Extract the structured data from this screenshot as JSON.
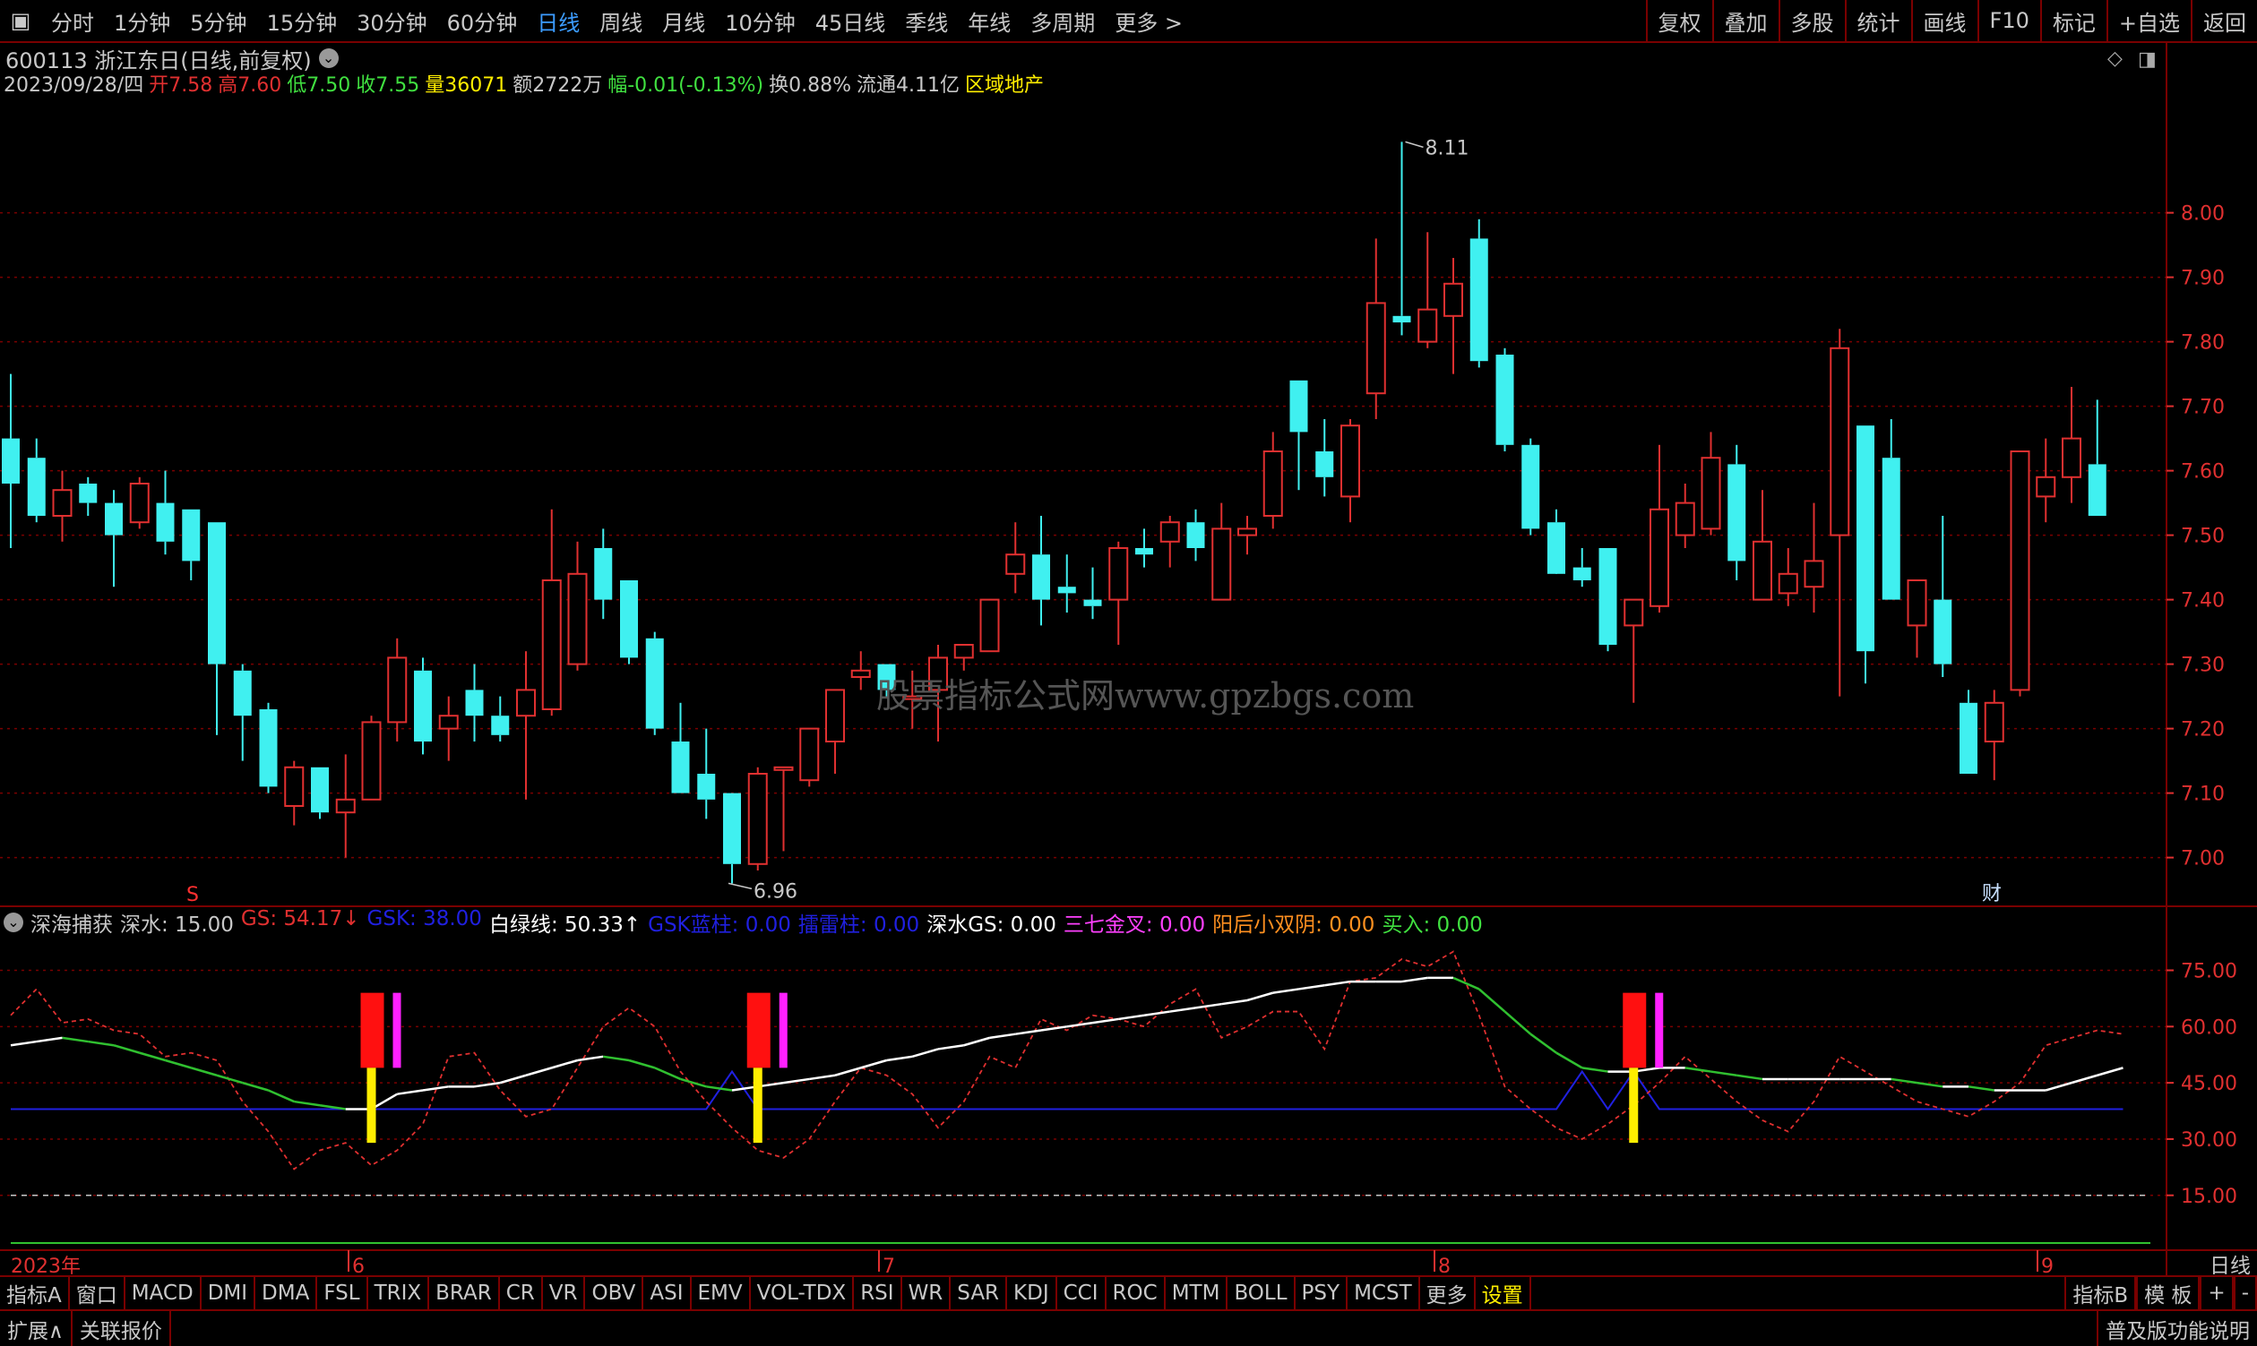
{
  "top_bar": {
    "periods": [
      {
        "label": "分时",
        "active": false
      },
      {
        "label": "1分钟",
        "active": false
      },
      {
        "label": "5分钟",
        "active": false
      },
      {
        "label": "15分钟",
        "active": false
      },
      {
        "label": "30分钟",
        "active": false
      },
      {
        "label": "60分钟",
        "active": false
      },
      {
        "label": "日线",
        "active": true
      },
      {
        "label": "周线",
        "active": false
      },
      {
        "label": "月线",
        "active": false
      },
      {
        "label": "10分钟",
        "active": false
      },
      {
        "label": "45日线",
        "active": false
      },
      {
        "label": "季线",
        "active": false
      },
      {
        "label": "年线",
        "active": false
      },
      {
        "label": "多周期",
        "active": false
      },
      {
        "label": "更多 >",
        "active": false
      }
    ],
    "tools": [
      "复权",
      "叠加",
      "多股",
      "统计",
      "画线",
      "F10",
      "标记",
      "+自选",
      "返回"
    ]
  },
  "stock": {
    "title": "600113 浙江东日(日线,前复权)",
    "date": "2023/09/28/四",
    "open": "开7.58",
    "high": "高7.60",
    "low": "低7.50",
    "close": "收7.55",
    "volume": "量36071",
    "amount": "额2722万",
    "change": "幅-0.01(-0.13%)",
    "turnover": "换0.88%",
    "float": "流通4.11亿",
    "sector": "区域地产"
  },
  "price_axis": [
    "8.00",
    "7.90",
    "7.80",
    "7.70",
    "7.60",
    "7.50",
    "7.40",
    "7.30",
    "7.20",
    "7.10",
    "7.00"
  ],
  "annotations": {
    "max_label": "8.11",
    "min_label": "6.96",
    "s_marker": "S",
    "cai_marker": "财",
    "watermark": "股票指标公式网www.gpzbgs.com"
  },
  "indicator": {
    "name": "深海捕获",
    "items": [
      {
        "label": "深水: 15.00",
        "color": "#c8c8c8"
      },
      {
        "label": "GS: 54.17↓",
        "color": "#e03030"
      },
      {
        "label": "GSK: 38.00",
        "color": "#2020e0"
      },
      {
        "label": "白绿线: 50.33↑",
        "color": "#ffffff"
      },
      {
        "label": "GSK蓝柱: 0.00",
        "color": "#2020e0"
      },
      {
        "label": "擂雷柱: 0.00",
        "color": "#2020e0"
      },
      {
        "label": "深水GS: 0.00",
        "color": "#ffffff"
      },
      {
        "label": "三七金叉: 0.00",
        "color": "#ff40ff"
      },
      {
        "label": "阳后小双阴: 0.00",
        "color": "#ff9020"
      },
      {
        "label": "买入: 0.00",
        "color": "#40e040"
      }
    ],
    "axis": [
      "75.00",
      "60.00",
      "45.00",
      "30.00",
      "15.00"
    ]
  },
  "date_axis": {
    "labels": [
      "2023年",
      "6",
      "7",
      "8",
      "9"
    ],
    "period": "日线"
  },
  "tabs": [
    "指标A",
    "窗口",
    "MACD",
    "DMI",
    "DMA",
    "FSL",
    "TRIX",
    "BRAR",
    "CR",
    "VR",
    "OBV",
    "ASI",
    "EMV",
    "VOL-TDX",
    "RSI",
    "WR",
    "SAR",
    "KDJ",
    "CCI",
    "ROC",
    "MTM",
    "BOLL",
    "PSY",
    "MCST",
    "更多",
    "设置"
  ],
  "tabs_right": [
    "指标B",
    "模 板",
    "+",
    "-"
  ],
  "status": {
    "expand": "扩展∧",
    "linked": "关联报价",
    "version": "普及版功能说明"
  },
  "colors": {
    "up": "#e03030",
    "down": "#40f0f0",
    "grid": "#7a0000",
    "white_line": "#ffffff",
    "green_line": "#30c030"
  },
  "chart_data": {
    "type": "candlestick",
    "ylim": [
      6.93,
      8.18
    ],
    "candles": [
      [
        7.65,
        7.75,
        7.48,
        7.58
      ],
      [
        7.62,
        7.65,
        7.52,
        7.53
      ],
      [
        7.53,
        7.6,
        7.49,
        7.57
      ],
      [
        7.58,
        7.59,
        7.53,
        7.55
      ],
      [
        7.55,
        7.57,
        7.42,
        7.5
      ],
      [
        7.52,
        7.59,
        7.51,
        7.58
      ],
      [
        7.55,
        7.6,
        7.47,
        7.49
      ],
      [
        7.54,
        7.54,
        7.43,
        7.46
      ],
      [
        7.52,
        7.52,
        7.19,
        7.3
      ],
      [
        7.29,
        7.3,
        7.15,
        7.22
      ],
      [
        7.23,
        7.24,
        7.1,
        7.11
      ],
      [
        7.08,
        7.15,
        7.05,
        7.14
      ],
      [
        7.14,
        7.14,
        7.06,
        7.07
      ],
      [
        7.07,
        7.16,
        7.0,
        7.09
      ],
      [
        7.09,
        7.22,
        7.09,
        7.21
      ],
      [
        7.21,
        7.34,
        7.18,
        7.31
      ],
      [
        7.29,
        7.31,
        7.16,
        7.18
      ],
      [
        7.2,
        7.25,
        7.15,
        7.22
      ],
      [
        7.26,
        7.3,
        7.18,
        7.22
      ],
      [
        7.22,
        7.25,
        7.18,
        7.19
      ],
      [
        7.22,
        7.32,
        7.09,
        7.26
      ],
      [
        7.23,
        7.54,
        7.22,
        7.43
      ],
      [
        7.3,
        7.49,
        7.29,
        7.44
      ],
      [
        7.48,
        7.51,
        7.37,
        7.4
      ],
      [
        7.43,
        7.43,
        7.3,
        7.31
      ],
      [
        7.34,
        7.35,
        7.19,
        7.2
      ],
      [
        7.18,
        7.24,
        7.1,
        7.1
      ],
      [
        7.13,
        7.2,
        7.06,
        7.09
      ],
      [
        7.1,
        7.09,
        6.96,
        6.99
      ],
      [
        6.99,
        7.14,
        6.98,
        7.13
      ],
      [
        7.14,
        7.13,
        7.01,
        7.14
      ],
      [
        7.12,
        7.2,
        7.11,
        7.2
      ],
      [
        7.18,
        7.24,
        7.13,
        7.26
      ],
      [
        7.28,
        7.32,
        7.26,
        7.29
      ],
      [
        7.3,
        7.3,
        7.25,
        7.26
      ],
      [
        7.25,
        7.29,
        7.2,
        7.25
      ],
      [
        7.26,
        7.33,
        7.18,
        7.31
      ],
      [
        7.31,
        7.33,
        7.29,
        7.33
      ],
      [
        7.32,
        7.39,
        7.32,
        7.4
      ],
      [
        7.44,
        7.52,
        7.41,
        7.47
      ],
      [
        7.47,
        7.53,
        7.36,
        7.4
      ],
      [
        7.42,
        7.47,
        7.38,
        7.41
      ],
      [
        7.4,
        7.45,
        7.37,
        7.39
      ],
      [
        7.4,
        7.49,
        7.33,
        7.48
      ],
      [
        7.48,
        7.51,
        7.45,
        7.47
      ],
      [
        7.49,
        7.53,
        7.45,
        7.52
      ],
      [
        7.52,
        7.54,
        7.46,
        7.48
      ],
      [
        7.4,
        7.55,
        7.4,
        7.51
      ],
      [
        7.5,
        7.53,
        7.47,
        7.51
      ],
      [
        7.53,
        7.66,
        7.51,
        7.63
      ],
      [
        7.74,
        7.74,
        7.57,
        7.66
      ],
      [
        7.63,
        7.68,
        7.56,
        7.59
      ],
      [
        7.56,
        7.68,
        7.52,
        7.67
      ],
      [
        7.72,
        7.96,
        7.68,
        7.86
      ],
      [
        7.84,
        8.11,
        7.81,
        7.83
      ],
      [
        7.8,
        7.97,
        7.79,
        7.85
      ],
      [
        7.84,
        7.93,
        7.75,
        7.89
      ],
      [
        7.96,
        7.99,
        7.76,
        7.77
      ],
      [
        7.78,
        7.79,
        7.63,
        7.64
      ],
      [
        7.64,
        7.65,
        7.5,
        7.51
      ],
      [
        7.52,
        7.54,
        7.47,
        7.44
      ],
      [
        7.45,
        7.48,
        7.42,
        7.43
      ],
      [
        7.48,
        7.48,
        7.32,
        7.33
      ],
      [
        7.36,
        7.4,
        7.24,
        7.4
      ],
      [
        7.39,
        7.64,
        7.38,
        7.54
      ],
      [
        7.5,
        7.58,
        7.48,
        7.55
      ],
      [
        7.51,
        7.66,
        7.5,
        7.62
      ],
      [
        7.61,
        7.64,
        7.43,
        7.46
      ],
      [
        7.4,
        7.57,
        7.4,
        7.49
      ],
      [
        7.41,
        7.48,
        7.39,
        7.44
      ],
      [
        7.42,
        7.55,
        7.38,
        7.46
      ],
      [
        7.5,
        7.82,
        7.25,
        7.79
      ],
      [
        7.67,
        7.67,
        7.27,
        7.32
      ],
      [
        7.62,
        7.68,
        7.4,
        7.4
      ],
      [
        7.36,
        7.43,
        7.31,
        7.43
      ],
      [
        7.4,
        7.53,
        7.28,
        7.3
      ],
      [
        7.24,
        7.26,
        7.13,
        7.13
      ],
      [
        7.18,
        7.26,
        7.12,
        7.24
      ],
      [
        7.26,
        7.63,
        7.25,
        7.63
      ],
      [
        7.56,
        7.65,
        7.52,
        7.59
      ],
      [
        7.59,
        7.73,
        7.55,
        7.65
      ],
      [
        7.61,
        7.71,
        7.53,
        7.53
      ]
    ],
    "indicator_series": {
      "gs": [
        63,
        70,
        61,
        62,
        59,
        58,
        52,
        53,
        51,
        40,
        32,
        22,
        27,
        29,
        23,
        27,
        34,
        52,
        53,
        43,
        36,
        38,
        49,
        60,
        65,
        60,
        48,
        40,
        33,
        27,
        25,
        30,
        40,
        49,
        47,
        42,
        33,
        40,
        52,
        49,
        62,
        59,
        63,
        62,
        60,
        66,
        70,
        57,
        60,
        64,
        64,
        54,
        72,
        73,
        78,
        76,
        80,
        63,
        44,
        38,
        33,
        30,
        34,
        39,
        45,
        52,
        46,
        40,
        35,
        32,
        40,
        52,
        48,
        44,
        40,
        38,
        36,
        40,
        45,
        55,
        57,
        59,
        58
      ],
      "white_green": [
        55,
        56,
        57,
        56,
        55,
        53,
        51,
        49,
        47,
        45,
        43,
        40,
        39,
        38,
        38,
        42,
        43,
        44,
        44,
        45,
        47,
        49,
        51,
        52,
        51,
        49,
        46,
        44,
        43,
        44,
        45,
        46,
        47,
        49,
        51,
        52,
        54,
        55,
        57,
        58,
        59,
        60,
        61,
        62,
        63,
        64,
        65,
        66,
        67,
        69,
        70,
        71,
        72,
        72,
        72,
        73,
        73,
        70,
        64,
        58,
        53,
        49,
        48,
        48,
        49,
        49,
        48,
        47,
        46,
        46,
        46,
        46,
        46,
        46,
        45,
        44,
        44,
        43,
        43,
        43,
        45,
        47,
        49
      ],
      "gsk": [
        38,
        38,
        38,
        38,
        38,
        38,
        38,
        38,
        38,
        38,
        38,
        38,
        38,
        38,
        38,
        38,
        38,
        38,
        38,
        38,
        38,
        38,
        38,
        38,
        38,
        38,
        38,
        38,
        48,
        38,
        38,
        38,
        38,
        38,
        38,
        38,
        38,
        38,
        38,
        38,
        38,
        38,
        38,
        38,
        38,
        38,
        38,
        38,
        38,
        38,
        38,
        38,
        38,
        38,
        38,
        38,
        38,
        38,
        38,
        38,
        38,
        48,
        38,
        48,
        38,
        38,
        38,
        38,
        38,
        38,
        38,
        38,
        38,
        38,
        38,
        38,
        38,
        38,
        38,
        38,
        38,
        38,
        38
      ],
      "shenshui": 15,
      "signals": [
        14,
        29,
        63
      ],
      "ylim": [
        3,
        83
      ]
    }
  }
}
